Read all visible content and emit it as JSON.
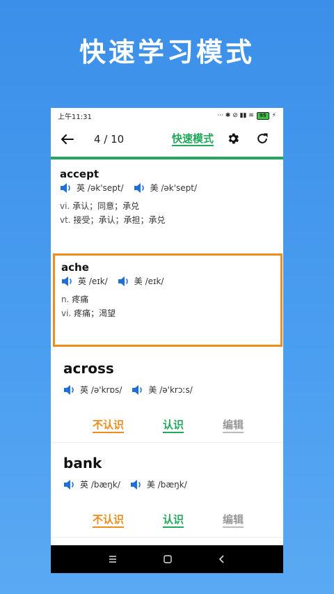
{
  "hero": {
    "title": "快速学习模式"
  },
  "status_bar": {
    "time": "上午11:31",
    "icons": "··· ✱ ⊘ ▮▮ ≋",
    "battery": "95",
    "charging": "⚡"
  },
  "toolbar": {
    "counter": "4 / 10",
    "mode_label": "快速模式"
  },
  "cards": [
    {
      "word": "accept",
      "phonetics": {
        "uk_label": "英",
        "uk": "/ək'sept/",
        "us_label": "美",
        "us": "/ək'sept/"
      },
      "definitions": [
        {
          "pos": "vi.",
          "text": "承认；同意；承兑"
        },
        {
          "pos": "vt.",
          "text": "接受；承认；承担；承兑"
        }
      ]
    },
    {
      "word": "ache",
      "phonetics": {
        "uk_label": "英",
        "uk": "/eɪk/",
        "us_label": "美",
        "us": "/eɪk/"
      },
      "definitions": [
        {
          "pos": "n.",
          "text": "疼痛"
        },
        {
          "pos": "vi.",
          "text": "疼痛；渴望"
        }
      ]
    },
    {
      "word": "across",
      "phonetics": {
        "uk_label": "英",
        "uk": "/ə'krɒs/",
        "us_label": "美",
        "us": "/ə'krɔːs/"
      },
      "actions": {
        "unknown": "不认识",
        "known": "认识",
        "edit": "编辑"
      }
    },
    {
      "word": "bank",
      "phonetics": {
        "uk_label": "英",
        "uk": "/bæŋk/",
        "us_label": "美",
        "us": "/bæŋk/"
      },
      "actions": {
        "unknown": "不认识",
        "known": "认识",
        "edit": "编辑"
      }
    }
  ],
  "colors": {
    "accent_green": "#22a85a",
    "accent_orange": "#f08c1a",
    "speaker_blue": "#1e6fd9",
    "background_blue": "#4b9ef0"
  },
  "icons": [
    "back-arrow-icon",
    "gear-icon",
    "refresh-icon",
    "speaker-icon",
    "menu-icon",
    "home-square-icon",
    "back-chevron-icon"
  ]
}
